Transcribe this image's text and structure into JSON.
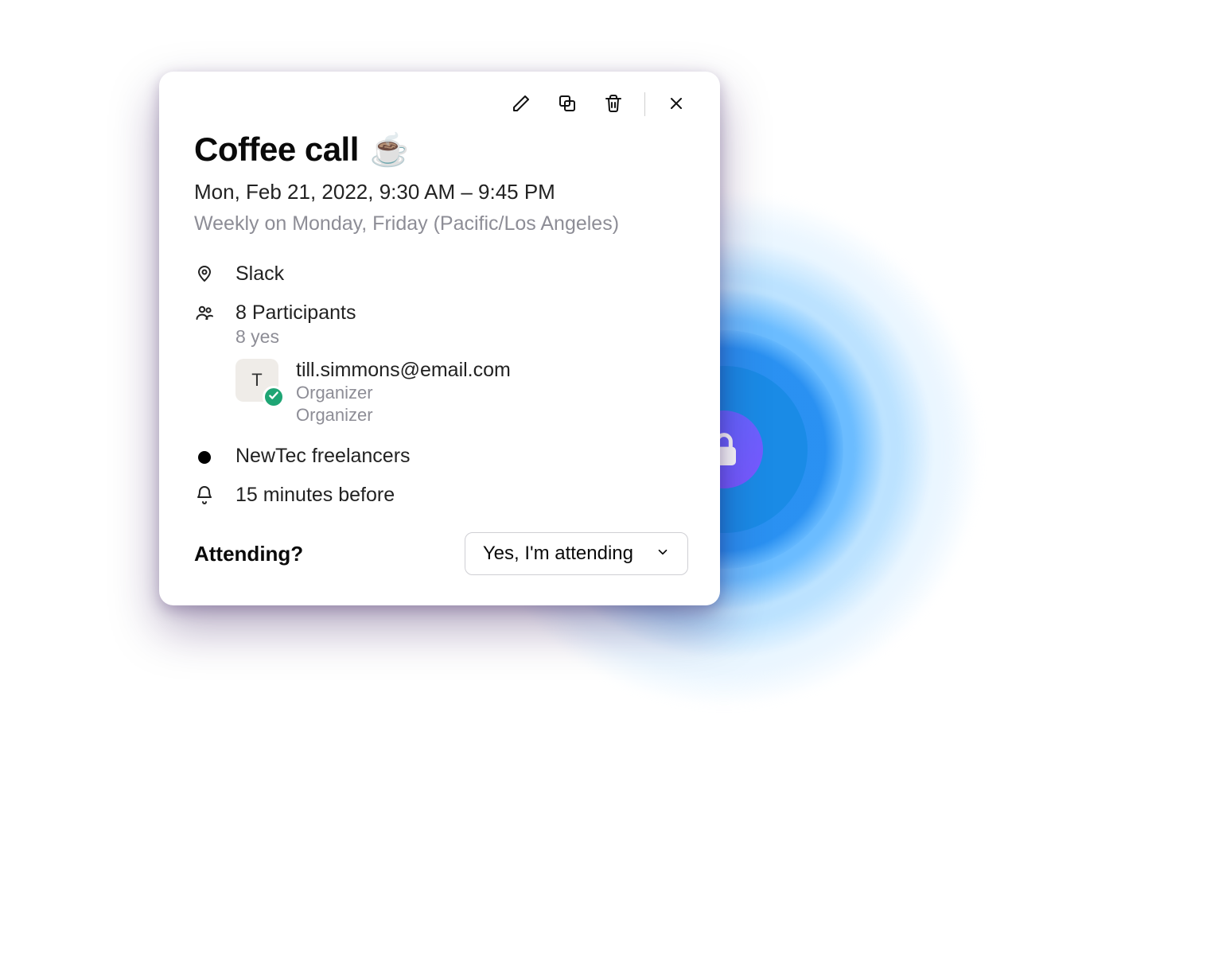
{
  "event": {
    "title": "Coffee call",
    "emoji": "☕",
    "datetime": "Mon, Feb 21, 2022, 9:30 AM – 9:45 PM",
    "recurrence": "Weekly on Monday, Friday (Pacific/Los Angeles)",
    "location": "Slack",
    "participants_line": "8 Participants",
    "participants_sub": "8 yes",
    "organizer": {
      "initial": "T",
      "email": "till.simmons@email.com",
      "role1": "Organizer",
      "role2": "Organizer"
    },
    "calendar": "NewTec freelancers",
    "reminder": "15 minutes before"
  },
  "attending": {
    "label": "Attending?",
    "selected": "Yes, I'm attending"
  }
}
